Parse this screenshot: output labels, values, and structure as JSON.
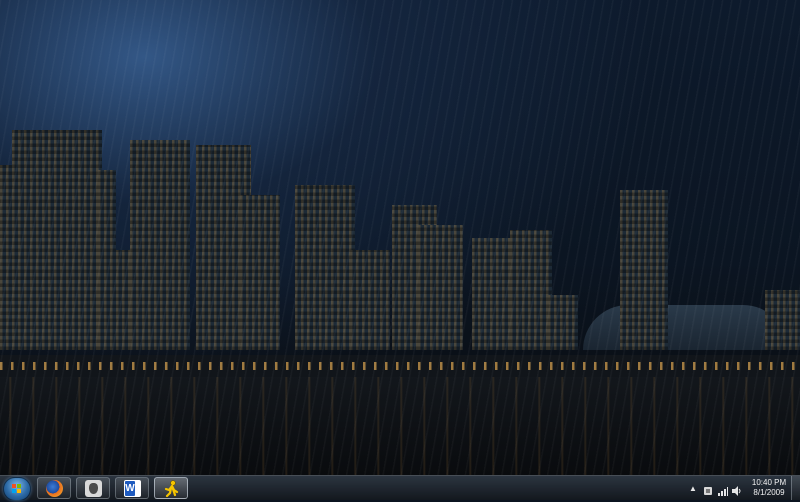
{
  "desktop": {
    "wallpaper": "night city skyline over water"
  },
  "taskbar": {
    "start_button": "start-orb",
    "pinned": [
      {
        "name": "firefox",
        "icon": "firefox-icon"
      },
      {
        "name": "wolf-app",
        "icon": "wolf-icon"
      },
      {
        "name": "word",
        "icon": "word-icon"
      },
      {
        "name": "aim",
        "icon": "aim-running-man-icon",
        "active": true
      }
    ]
  },
  "tray": {
    "icons": [
      "show-hidden-icons-chevron",
      "tray-app-icon",
      "network-icon",
      "volume-icon"
    ],
    "clock": {
      "time": "10:40 PM",
      "date": "8/1/2009"
    }
  },
  "colors": {
    "taskbar": "#1e242c",
    "accent_light": "#e6aa50",
    "start_blue": "#2c6aa6"
  }
}
